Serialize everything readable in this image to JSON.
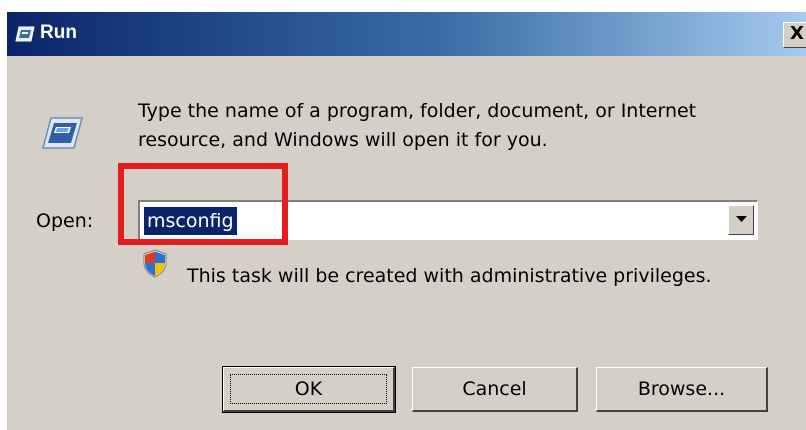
{
  "window": {
    "title": "Run",
    "close_glyph": "X",
    "icon": "run-icon"
  },
  "dialog": {
    "prompt_line_1": "Type the name of a program, folder, document, or Internet",
    "prompt_line_2": "resource, and Windows will open it for you.",
    "open_label": "Open:",
    "open_value": "msconfig",
    "admin_note": "This task will be created with administrative privileges.",
    "icons": {
      "run": "run-icon",
      "shield": "uac-shield-icon",
      "dropdown": "chevron-down-icon"
    }
  },
  "buttons": {
    "ok": "OK",
    "cancel": "Cancel",
    "browse": "Browse..."
  },
  "colors": {
    "title_bar_start": "#0a246a",
    "title_bar_end": "#a6caf0",
    "dialog_face": "#d4d0c8",
    "selection": "#0a246a",
    "highlight_box": "#e41e1e"
  }
}
